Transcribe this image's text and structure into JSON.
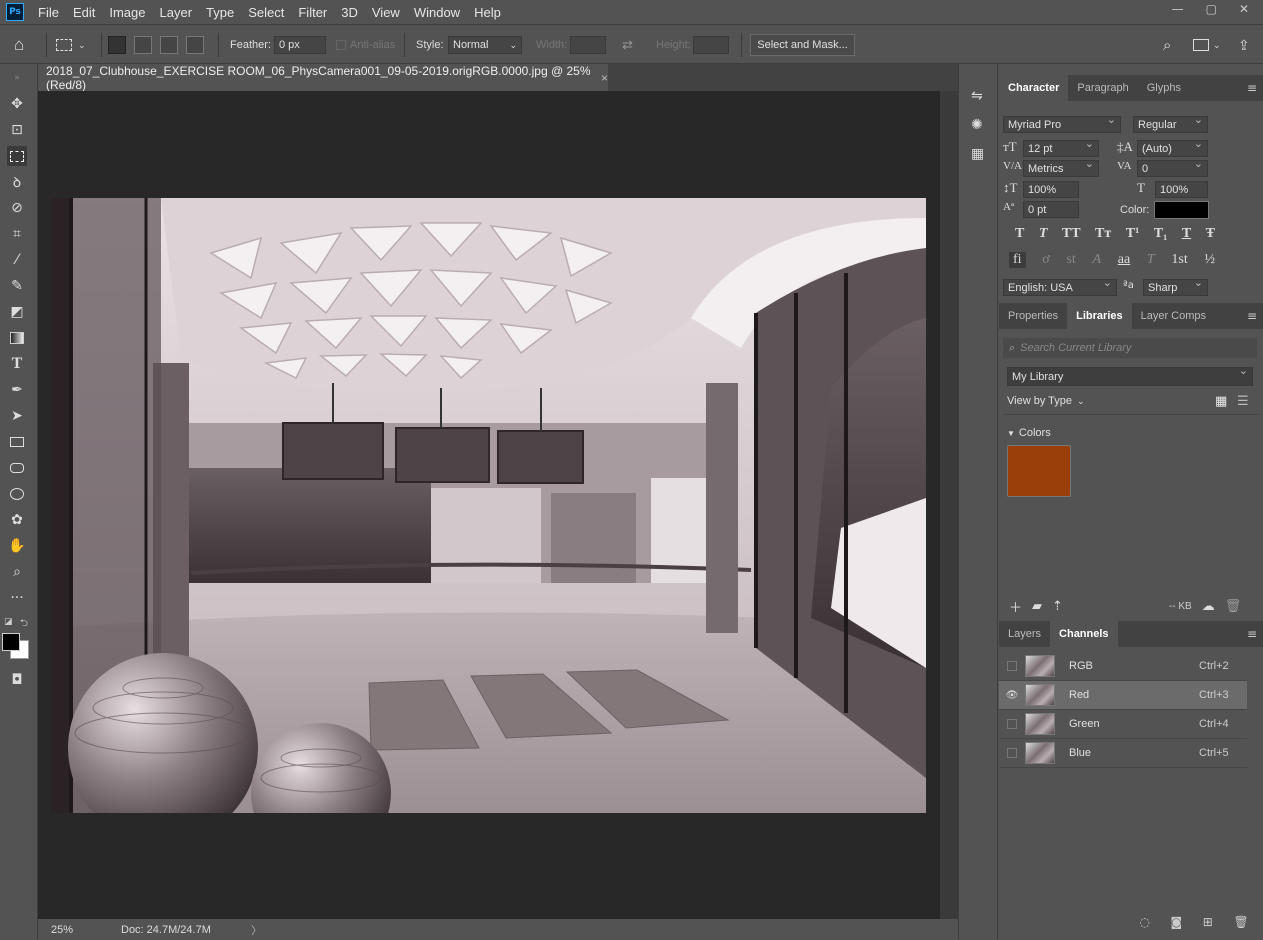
{
  "app": {
    "logo": "Ps"
  },
  "menu": [
    "File",
    "Edit",
    "Image",
    "Layer",
    "Type",
    "Select",
    "Filter",
    "3D",
    "View",
    "Window",
    "Help"
  ],
  "window_controls": [
    "minimize-icon",
    "restore-icon",
    "close-icon"
  ],
  "options": {
    "feather_label": "Feather:",
    "feather_value": "0 px",
    "antialias_label": "Anti-alias",
    "style_label": "Style:",
    "style_value": "Normal",
    "width_label": "Width:",
    "height_label": "Height:",
    "select_mask_label": "Select and Mask..."
  },
  "document": {
    "tab_title": "2018_07_Clubhouse_EXERCISE ROOM_06_PhysCamera001_09-05-2019.origRGB.0000.jpg @ 25% (Red/8)",
    "close_symbol": "×"
  },
  "status": {
    "zoom": "25%",
    "doc_info": "Doc: 24.7M/24.7M",
    "arrow": "〉"
  },
  "character": {
    "tabs": [
      "Character",
      "Paragraph",
      "Glyphs"
    ],
    "font_family": "Myriad Pro",
    "font_style": "Regular",
    "font_size": "12 pt",
    "leading": "(Auto)",
    "kerning": "Metrics",
    "tracking": "0",
    "vscale": "100%",
    "hscale": "100%",
    "baseline": "0 pt",
    "color_label": "Color:",
    "color_value": "#000000",
    "style_buttons": [
      "T",
      "T",
      "TT",
      "Tт",
      "T¹",
      "T₁",
      "T",
      "Ŧ"
    ],
    "opentype_buttons": [
      "fi",
      "ơ",
      "st",
      "A",
      "aa",
      "T",
      "1st",
      "½"
    ],
    "language": "English: USA",
    "aa_symbol": "ªa",
    "antialias": "Sharp"
  },
  "libraries": {
    "tabs": [
      "Properties",
      "Libraries",
      "Layer Comps"
    ],
    "search_placeholder": "Search Current Library",
    "library_name": "My Library",
    "view_by": "View by Type",
    "colors_label": "Colors",
    "swatch_color": "#9a3f0a",
    "size_text": "-- KB"
  },
  "channels": {
    "tabs": [
      "Layers",
      "Channels"
    ],
    "rows": [
      {
        "name": "RGB",
        "shortcut": "Ctrl+2",
        "visible": false,
        "selected": false
      },
      {
        "name": "Red",
        "shortcut": "Ctrl+3",
        "visible": true,
        "selected": true
      },
      {
        "name": "Green",
        "shortcut": "Ctrl+4",
        "visible": false,
        "selected": false
      },
      {
        "name": "Blue",
        "shortcut": "Ctrl+5",
        "visible": false,
        "selected": false
      }
    ]
  },
  "tools": [
    "move-tool-icon",
    "artboard-tool-icon",
    "marquee-tool-icon",
    "lasso-tool-icon",
    "quick-select-tool-icon",
    "crop-tool-icon",
    "eyedropper-tool-icon",
    "brush-tool-icon",
    "eraser-tool-icon",
    "gradient-tool-icon",
    "type-tool-icon",
    "pen-tool-icon",
    "path-select-tool-icon",
    "rectangle-tool-icon",
    "rounded-rect-tool-icon",
    "ellipse-tool-icon",
    "custom-shape-tool-icon",
    "hand-tool-icon",
    "zoom-tool-icon",
    "more-tools-icon"
  ],
  "colors": {
    "foreground": "#000000",
    "background": "#ffffff"
  }
}
